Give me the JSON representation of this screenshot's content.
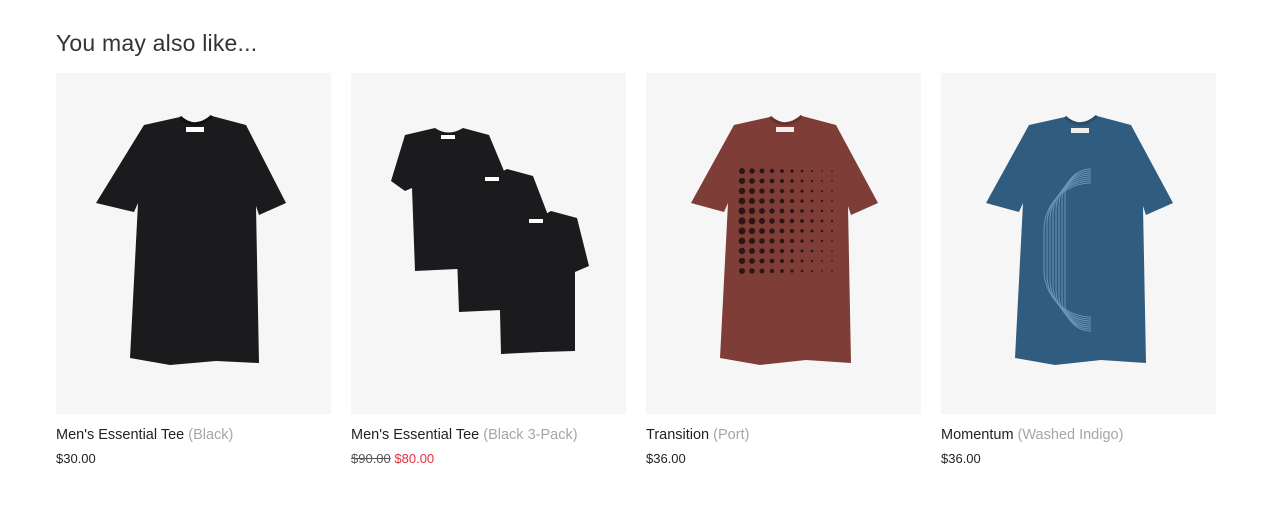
{
  "section": {
    "title": "You may also like..."
  },
  "products": [
    {
      "name": "Men's Essential Tee",
      "variant": "(Black)",
      "price": "$30.00",
      "image_icon": "black-tshirt-icon",
      "shirt_color": "#1b1b1d"
    },
    {
      "name": "Men's Essential Tee",
      "variant": "(Black 3-Pack)",
      "price_original": "$90.00",
      "price_sale": "$80.00",
      "image_icon": "black-tshirt-3-pack-icon",
      "shirt_color": "#1b1b1d",
      "sale_color": "#e4303c"
    },
    {
      "name": "Transition",
      "variant": "(Port)",
      "price": "$36.00",
      "image_icon": "port-dot-graphic-tshirt-icon",
      "shirt_color": "#7e3d37"
    },
    {
      "name": "Momentum",
      "variant": "(Washed Indigo)",
      "price": "$36.00",
      "image_icon": "indigo-arc-graphic-tshirt-icon",
      "shirt_color": "#2f5c7f"
    }
  ]
}
